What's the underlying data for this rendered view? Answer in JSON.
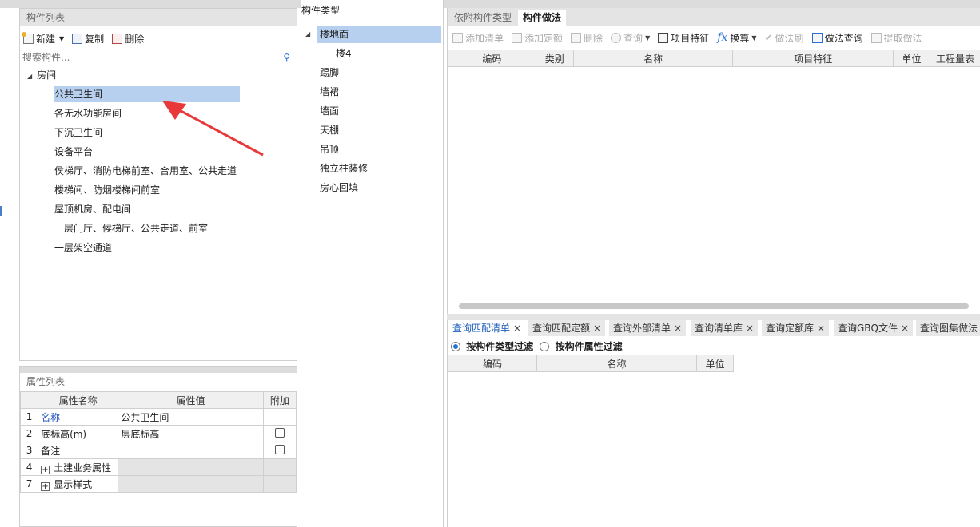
{
  "component_list": {
    "title": "构件列表",
    "toolbar": {
      "new": "新建",
      "copy": "复制",
      "delete": "删除"
    },
    "search_placeholder": "搜索构件...",
    "root": "房间",
    "items": [
      "公共卫生间",
      "各无水功能房间",
      "下沉卫生间",
      "设备平台",
      "侯梯厅、消防电梯前室、合用室、公共走道",
      "楼梯间、防烟楼梯间前室",
      "屋顶机房、配电间",
      "一层门厅、候梯厅、公共走道、前室",
      "一层架空通道"
    ]
  },
  "property_list": {
    "title": "属性列表",
    "headers": [
      "属性名称",
      "属性值",
      "附加"
    ],
    "rows": [
      {
        "num": "1",
        "name": "名称",
        "value": "公共卫生间"
      },
      {
        "num": "2",
        "name": "底标高(m)",
        "value": "层底标高"
      },
      {
        "num": "3",
        "name": "备注",
        "value": ""
      },
      {
        "num": "4",
        "name": "土建业务属性",
        "value": ""
      },
      {
        "num": "7",
        "name": "显示样式",
        "value": ""
      }
    ]
  },
  "component_types": {
    "title": "构件类型",
    "items": [
      "楼地面",
      "楼4",
      "踢脚",
      "墙裙",
      "墙面",
      "天棚",
      "吊顶",
      "独立柱装修",
      "房心回填"
    ]
  },
  "methods": {
    "tabs": [
      "依附构件类型",
      "构件做法"
    ],
    "toolbar": [
      "添加清单",
      "添加定额",
      "删除",
      "查询",
      "项目特征",
      "换算",
      "做法刷",
      "做法查询",
      "提取做法"
    ],
    "headers": [
      "编码",
      "类别",
      "名称",
      "项目特征",
      "单位",
      "工程量表"
    ]
  },
  "query": {
    "tabs": [
      "查询匹配清单",
      "查询匹配定额",
      "查询外部清单",
      "查询清单库",
      "查询定额库",
      "查询GBQ文件",
      "查询图集做法"
    ],
    "close": "×",
    "filter_type": "按构件类型过滤",
    "filter_attr": "按构件属性过滤",
    "headers": [
      "编码",
      "名称",
      "单位"
    ]
  },
  "icons": {
    "fx": "fx"
  },
  "colors": {
    "selection": "#b8d0ef",
    "link": "#1f4fbf",
    "active_tab": "#1f5fb8",
    "arrow": "#e8383a"
  }
}
